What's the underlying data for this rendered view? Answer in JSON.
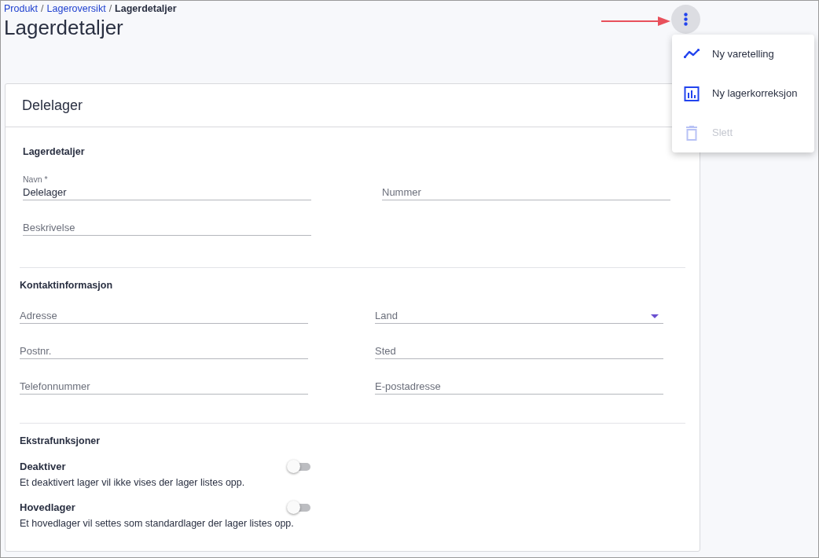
{
  "breadcrumb": [
    {
      "label": "Produkt",
      "current": false
    },
    {
      "separator_before": "/",
      "label": "Lageroversikt",
      "current": false
    },
    {
      "separator_before": "/",
      "label": "Lagerdetaljer",
      "current": true
    }
  ],
  "title": "Lagerdetaljer",
  "card": {
    "title": "Delelager",
    "sections": [
      {
        "heading": "Lagerdetaljer",
        "kind": "fields",
        "fields": [
          {
            "kind": "text",
            "label": "Navn *",
            "value": "Delelager"
          },
          {
            "kind": "text",
            "placeholder": "Nummer"
          },
          {
            "kind": "text",
            "placeholder": "Beskrivelse"
          }
        ]
      },
      {
        "heading": "Kontaktinformasjon",
        "kind": "fields",
        "fields": [
          {
            "kind": "text",
            "placeholder": "Adresse"
          },
          {
            "kind": "select",
            "placeholder": "Land"
          },
          {
            "kind": "text",
            "placeholder": "Postnr."
          },
          {
            "kind": "text",
            "placeholder": "Sted"
          },
          {
            "kind": "text",
            "placeholder": "Telefonnummer"
          },
          {
            "kind": "text",
            "placeholder": "E-postadresse"
          }
        ]
      },
      {
        "heading": "Ekstrafunksjoner",
        "kind": "toggles",
        "toggles": [
          {
            "label": "Deaktiver",
            "description": "Et deaktivert lager vil ikke vises der lager listes opp.",
            "on": false
          },
          {
            "label": "Hovedlager",
            "description": "Et hovedlager vil settes som standardlager der lager listes opp.",
            "on": false
          }
        ]
      }
    ]
  },
  "menu": {
    "items": [
      {
        "kind": "trend",
        "label": "Ny varetelling",
        "disabled": false
      },
      {
        "kind": "chart",
        "label": "Ny lagerkorreksjon",
        "disabled": false
      },
      {
        "kind": "trash",
        "label": "Slett",
        "disabled": true
      }
    ]
  }
}
